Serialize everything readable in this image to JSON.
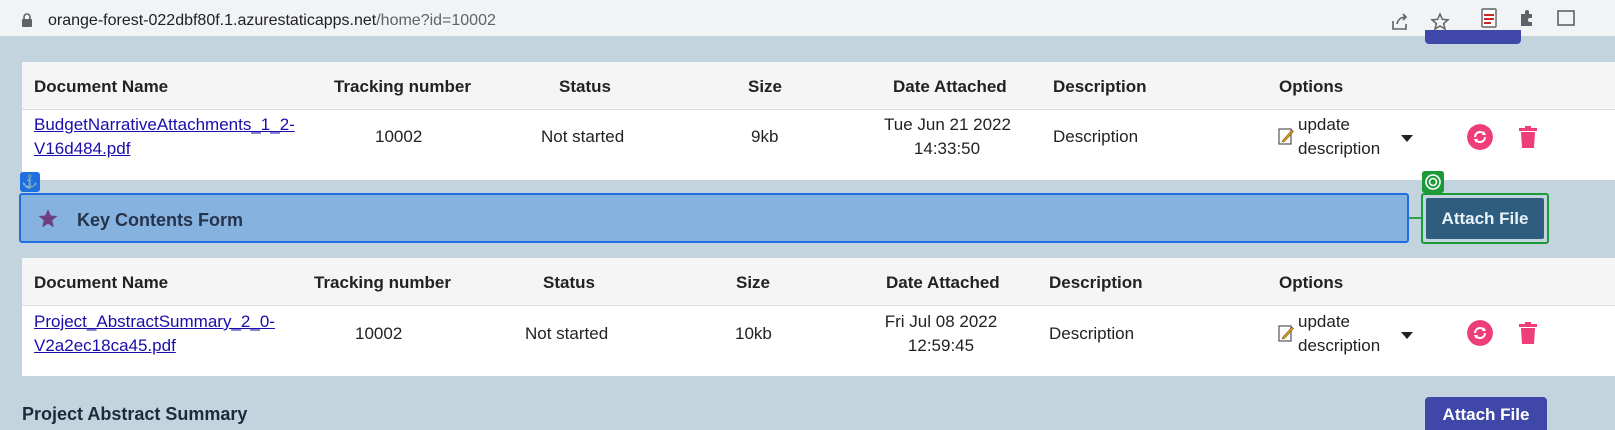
{
  "browser": {
    "url_host": "orange-forest-022dbf80f.1.azurestaticapps.net",
    "url_path": "/home?id=10002",
    "icons": [
      "lock-icon",
      "share-icon",
      "star-icon",
      "pdf-extension-icon",
      "extensions-icon",
      "window-icon"
    ]
  },
  "table1": {
    "headers": [
      "Document Name",
      "Tracking number",
      "Status",
      "Size",
      "Date Attached",
      "Description",
      "Options"
    ],
    "row": {
      "doc_line1": "BudgetNarrativeAttachments_1_2-",
      "doc_line2": "V16d484.pdf",
      "tracking": "10002",
      "status": "Not started",
      "size": "9kb",
      "date_line1": "Tue Jun 21 2022",
      "date_line2": "14:33:50",
      "description": "Description",
      "option_line1": "update",
      "option_line2": "description"
    }
  },
  "form": {
    "title": "Key Contents Form",
    "attach_label": "Attach File",
    "anchor_glyph": "⚓"
  },
  "table2": {
    "headers": [
      "Document Name",
      "Tracking number",
      "Status",
      "Size",
      "Date Attached",
      "Description",
      "Options"
    ],
    "row": {
      "doc_line1": "Project_AbstractSummary_2_0-",
      "doc_line2": "V2a2ec18ca45.pdf",
      "tracking": "10002",
      "status": "Not started",
      "size": "10kb",
      "date_line1": "Fri Jul 08 2022",
      "date_line2": "12:59:45",
      "description": "Description",
      "option_line1": "update",
      "option_line2": "description"
    }
  },
  "next_section": {
    "title": "Project Abstract Summary",
    "attach_label": "Attach File"
  },
  "colors": {
    "section_bg": "#c3d4df",
    "form_bg": "#86b2e0",
    "accent_blue": "#1f6fe0",
    "attach_btn": "#2e5d80",
    "primary_btn": "#3f48a8",
    "danger": "#ee3e7a",
    "highlight_green": "#1c9a38"
  }
}
